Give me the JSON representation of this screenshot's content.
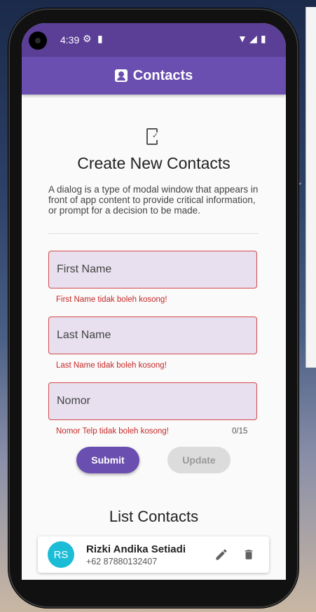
{
  "status": {
    "time": "4:39"
  },
  "appbar": {
    "title": "Contacts"
  },
  "form": {
    "heading": "Create New Contacts",
    "description": "A dialog is a type of modal window that appears in front of app content to provide critical information, or prompt for a decision to be made.",
    "first_name": {
      "placeholder": "First Name",
      "value": "",
      "error": "First Name tidak boleh kosong!"
    },
    "last_name": {
      "placeholder": "Last Name",
      "value": "",
      "error": "Last Name tidak boleh kosong!"
    },
    "nomor": {
      "placeholder": "Nomor",
      "value": "",
      "error": "Nomor Telp tidak boleh kosong!",
      "counter": "0/15"
    },
    "submit_label": "Submit",
    "update_label": "Update"
  },
  "list": {
    "heading": "List Contacts",
    "contacts": [
      {
        "initials": "RS",
        "name": "Rizki Andika Setiadi",
        "phone": "+62 87880132407"
      }
    ]
  },
  "colors": {
    "primary": "#6a4fb0",
    "status_bar": "#5b3f96",
    "error": "#c62828",
    "avatar": "#1bbcd6"
  }
}
